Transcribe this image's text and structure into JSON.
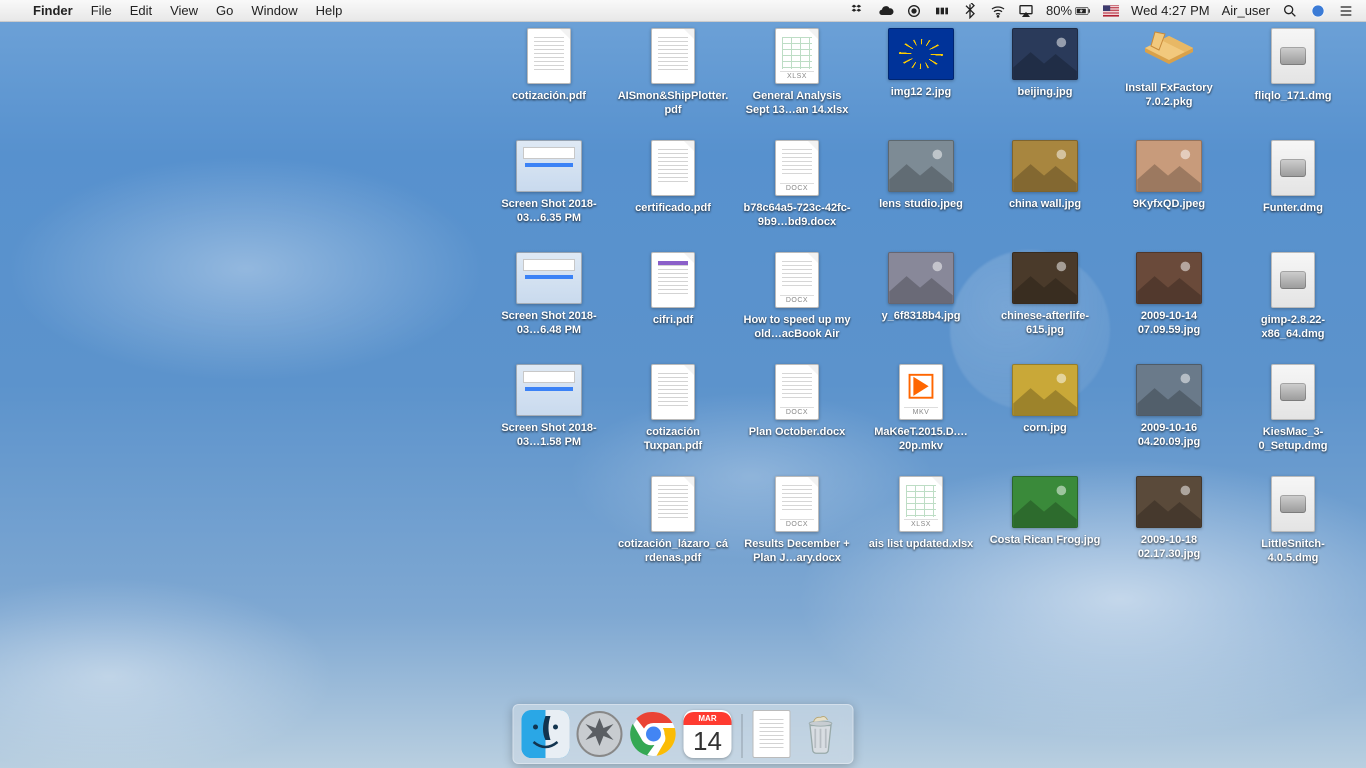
{
  "menubar": {
    "app": "Finder",
    "items": [
      "File",
      "Edit",
      "View",
      "Go",
      "Window",
      "Help"
    ],
    "battery": "80%",
    "clock": "Wed 4:27 PM",
    "user": "Air_user"
  },
  "desktop": [
    {
      "t": "pdf",
      "l": "cotización.pdf"
    },
    {
      "t": "pdf",
      "l": "AISmon&ShipPlotter.pdf"
    },
    {
      "t": "xlsx",
      "l": "General Analysis Sept 13…an 14.xlsx"
    },
    {
      "t": "flag",
      "l": "img12 2.jpg"
    },
    {
      "t": "img",
      "l": "beijing.jpg",
      "c": "#2a3a5a"
    },
    {
      "t": "pkg",
      "l": "Install FxFactory 7.0.2.pkg"
    },
    {
      "t": "dmg",
      "l": "fliqlo_171.dmg"
    },
    {
      "t": "shot",
      "l": "Screen Shot 2018-03…6.35 PM"
    },
    {
      "t": "pdf",
      "l": "certificado.pdf"
    },
    {
      "t": "docx",
      "l": "b78c64a5-723c-42fc-9b9…bd9.docx"
    },
    {
      "t": "img",
      "l": "lens studio.jpeg",
      "c": "#7d8b95"
    },
    {
      "t": "img",
      "l": "china wall.jpg",
      "c": "#a8863f"
    },
    {
      "t": "img",
      "l": "9KyfxQD.jpeg",
      "c": "#c89b7b"
    },
    {
      "t": "dmg",
      "l": "Funter.dmg"
    },
    {
      "t": "shot",
      "l": "Screen Shot 2018-03…6.48 PM"
    },
    {
      "t": "pdfc",
      "l": "cifri.pdf"
    },
    {
      "t": "docx",
      "l": "How to speed up my old…acBook Air"
    },
    {
      "t": "img",
      "l": "y_6f8318b4.jpg",
      "c": "#889"
    },
    {
      "t": "img",
      "l": "chinese-afterlife-615.jpg",
      "c": "#4a3a2a"
    },
    {
      "t": "img",
      "l": "2009-10-14 07.09.59.jpg",
      "c": "#6a4a3a"
    },
    {
      "t": "dmg",
      "l": "gimp-2.8.22-x86_64.dmg"
    },
    {
      "t": "shot",
      "l": "Screen Shot 2018-03…1.58 PM"
    },
    {
      "t": "pdf",
      "l": "cotización Tuxpan.pdf"
    },
    {
      "t": "docx",
      "l": "Plan October.docx"
    },
    {
      "t": "mkv",
      "l": "MaK6eT.2015.D.…20p.mkv"
    },
    {
      "t": "img",
      "l": "corn.jpg",
      "c": "#c9a838"
    },
    {
      "t": "img",
      "l": "2009-10-16 04.20.09.jpg",
      "c": "#6a7a8a"
    },
    {
      "t": "dmg",
      "l": "KiesMac_3-0_Setup.dmg"
    },
    {
      "t": "blank"
    },
    {
      "t": "pdf",
      "l": "cotización_lázaro_cárdenas.pdf"
    },
    {
      "t": "docx",
      "l": "Results December + Plan J…ary.docx"
    },
    {
      "t": "xlsx",
      "l": "ais list updated.xlsx"
    },
    {
      "t": "img",
      "l": "Costa Rican Frog.jpg",
      "c": "#3a8a3a"
    },
    {
      "t": "img",
      "l": "2009-10-18 02.17.30.jpg",
      "c": "#5a4a3a"
    },
    {
      "t": "dmg",
      "l": "LittleSnitch-4.0.5.dmg"
    }
  ],
  "dock": {
    "calendar_day": "14",
    "calendar_month": "MAR"
  }
}
